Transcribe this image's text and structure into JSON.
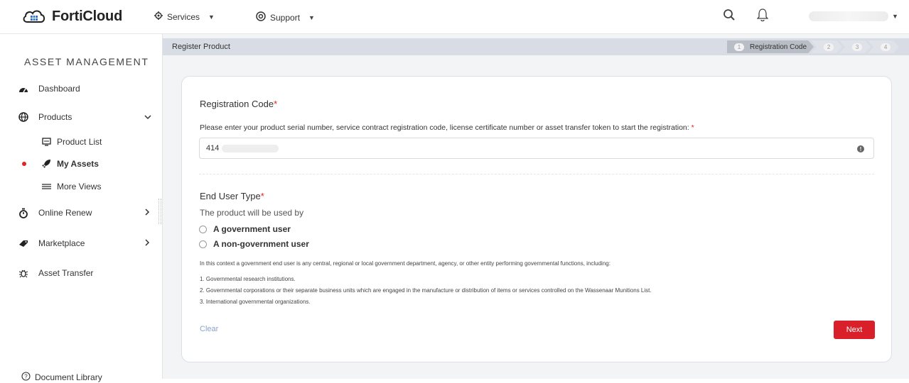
{
  "app": {
    "name": "FortiCloud"
  },
  "topnav": {
    "services_label": "Services",
    "support_label": "Support"
  },
  "sidebar": {
    "heading": "ASSET MANAGEMENT",
    "items": [
      {
        "label": "Dashboard",
        "icon": "gauge-icon"
      },
      {
        "label": "Products",
        "icon": "globe-icon",
        "expanded": true
      },
      {
        "label": "Product List",
        "icon": "monitor-icon"
      },
      {
        "label": "My Assets",
        "icon": "rocket-icon",
        "active": true
      },
      {
        "label": "More Views",
        "icon": "lines-icon"
      },
      {
        "label": "Online Renew",
        "icon": "stopwatch-icon"
      },
      {
        "label": "Marketplace",
        "icon": "tag-icon"
      },
      {
        "label": "Asset Transfer",
        "icon": "bug-icon"
      }
    ],
    "document_library": "Document Library"
  },
  "breadcrumb": {
    "title": "Register Product"
  },
  "steps": [
    {
      "num": "1",
      "label": "Registration Code",
      "active": true
    },
    {
      "num": "2",
      "label": ""
    },
    {
      "num": "3",
      "label": ""
    },
    {
      "num": "4",
      "label": ""
    }
  ],
  "form": {
    "reg_title": "Registration Code",
    "reg_help": "Please enter your product serial number, service contract registration code, license certificate number or asset transfer token to start the registration:",
    "reg_value": "414",
    "end_user_title": "End User Type",
    "used_by": "The product will be used by",
    "option_gov": "A government user",
    "option_nongov": "A non-government user",
    "note_intro": "In this context a government end user is any central, regional or local government department, agency, or other entity performing governmental functions, including:",
    "note_1": "1. Governmental research institutions.",
    "note_2": "2. Governmental corporations or their separate business units which are engaged in the manufacture or distribution of items or services controlled on the Wassenaar Munitions List.",
    "note_3": "3. International governmental organizations.",
    "clear_label": "Clear",
    "next_label": "Next"
  },
  "colors": {
    "accent": "#d9202a",
    "required": "#e02424",
    "sidebar_bg": "#ffffff",
    "main_bg": "#f3f4f6"
  }
}
